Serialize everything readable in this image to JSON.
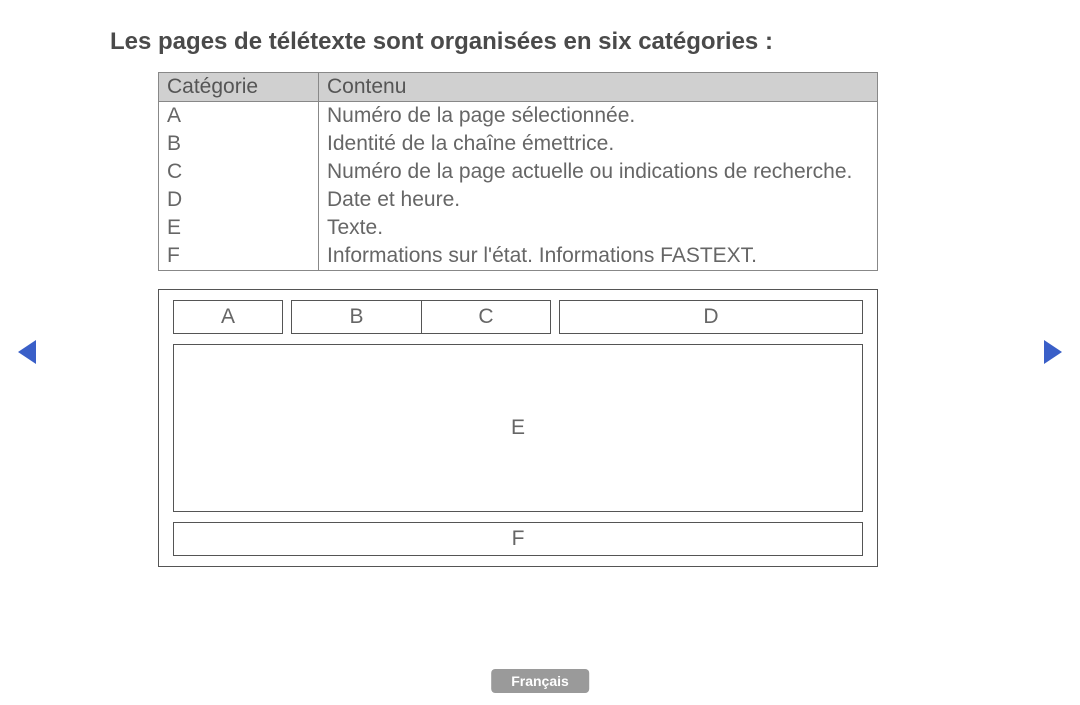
{
  "title": "Les pages de télétexte sont organisées en six catégories :",
  "table": {
    "headers": {
      "col1": "Catégorie",
      "col2": "Contenu"
    },
    "rows": [
      {
        "cat": "A",
        "content": "Numéro de la page sélectionnée."
      },
      {
        "cat": "B",
        "content": "Identité de la chaîne émettrice."
      },
      {
        "cat": "C",
        "content": "Numéro de la page actuelle ou indications de recherche."
      },
      {
        "cat": "D",
        "content": "Date et heure."
      },
      {
        "cat": "E",
        "content": "Texte."
      },
      {
        "cat": "F",
        "content": "Informations sur l'état. Informations FASTEXT."
      }
    ]
  },
  "diagram": {
    "a": "A",
    "b": "B",
    "c": "C",
    "d": "D",
    "e": "E",
    "f": "F"
  },
  "language": "Français"
}
